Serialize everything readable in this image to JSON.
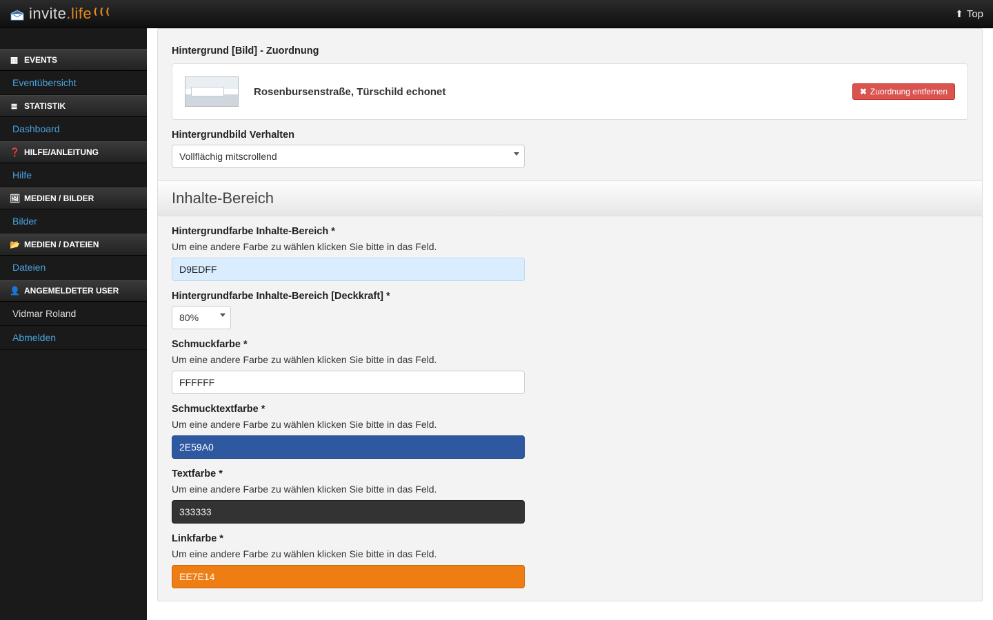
{
  "header": {
    "brand_part1": "invite",
    "brand_part2": ".life",
    "top_link": "Top"
  },
  "sidebar": {
    "groups": [
      {
        "title": "EVENTS",
        "icon": "grid",
        "links": [
          {
            "label": "Eventübersicht"
          }
        ]
      },
      {
        "title": "STATISTIK",
        "icon": "bars",
        "links": [
          {
            "label": "Dashboard"
          }
        ]
      },
      {
        "title": "HILFE/ANLEITUNG",
        "icon": "question",
        "links": [
          {
            "label": "Hilfe"
          }
        ]
      },
      {
        "title": "MEDIEN / BILDER",
        "icon": "image",
        "links": [
          {
            "label": "Bilder"
          }
        ]
      },
      {
        "title": "MEDIEN / DATEIEN",
        "icon": "folder",
        "links": [
          {
            "label": "Dateien"
          }
        ]
      },
      {
        "title": "ANGEMELDETER USER",
        "icon": "user",
        "links": [
          {
            "label_static": "Vidmar Roland"
          },
          {
            "label": "Abmelden"
          }
        ]
      }
    ]
  },
  "page": {
    "bg_assignment_label": "Hintergrund [Bild] - Zuordnung",
    "bg_item_title": "Rosenbursenstraße, Türschild echonet",
    "remove_assignment": "Zuordnung entfernen",
    "bg_behavior_label": "Hintergrundbild Verhalten",
    "bg_behavior_value": "Vollflächig mitscrollend",
    "section_title": "Inhalte-Bereich",
    "color_help": "Um eine andere Farbe zu wählen klicken Sie bitte in das Feld.",
    "fields": {
      "content_bg": {
        "label": "Hintergrundfarbe Inhalte-Bereich *",
        "value": "D9EDFF"
      },
      "content_bg_opacity": {
        "label": "Hintergrundfarbe Inhalte-Bereich [Deckkraft] *",
        "value": "80%"
      },
      "accent": {
        "label": "Schmuckfarbe *",
        "value": "FFFFFF"
      },
      "accent_text": {
        "label": "Schmucktextfarbe *",
        "value": "2E59A0"
      },
      "text": {
        "label": "Textfarbe *",
        "value": "333333"
      },
      "link": {
        "label": "Linkfarbe *",
        "value": "EE7E14"
      }
    }
  }
}
